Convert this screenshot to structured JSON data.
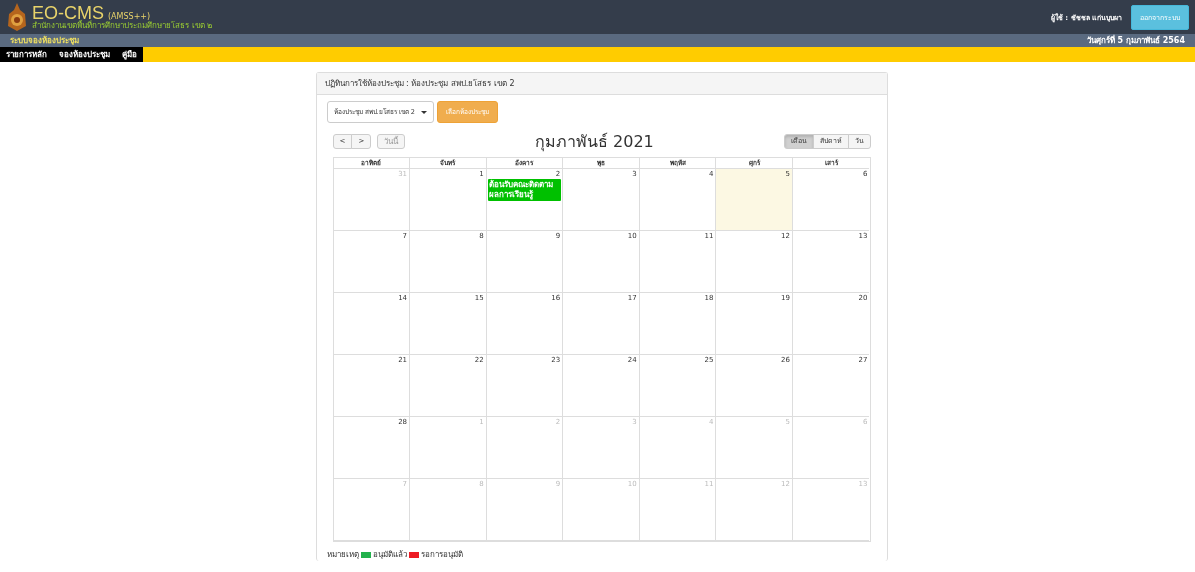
{
  "header": {
    "logo_title": "EO-CMS",
    "logo_suffix": "(AMSS++)",
    "subtitle": "สำนักงานเขตพื้นที่การศึกษาประถมศึกษายโสธร เขต ๒",
    "user": "ผู้ใช้ : ชัชชล แก่นบุบผา",
    "logout": "ออกจากระบบ"
  },
  "subbar": {
    "system": "ระบบจองห้องประชุม",
    "date": "วันศุกร์ที่ 5 กุมภาพันธ์ 2564"
  },
  "menu": [
    "รายการหลัก",
    "จองห้องประชุม",
    "คู่มือ"
  ],
  "panel": {
    "title": "ปฏิทินการใช้ห้องประชุม : ห้องประชุม สพป.ยโสธร เขต 2",
    "room_select": "ห้องประชุม สพป.ยโสธร เขต 2",
    "choose_button": "เลือกห้องประชุม"
  },
  "toolbar": {
    "prev": "<",
    "next": ">",
    "today": "วันนี้",
    "title": "กุมภาพันธ์ 2021",
    "views": [
      {
        "label": "เดือน",
        "selected": true
      },
      {
        "label": "สัปดาห์",
        "selected": false
      },
      {
        "label": "วัน",
        "selected": false
      }
    ]
  },
  "weekdays": [
    "อาทิตย์",
    "จันทร์",
    "อังคาร",
    "พุธ",
    "พฤหัส",
    "ศุกร์",
    "เสาร์"
  ],
  "weeks": [
    [
      {
        "day": "31",
        "other_month": true,
        "today": false
      },
      {
        "day": "1",
        "other_month": false,
        "today": false
      },
      {
        "day": "2",
        "other_month": false,
        "today": false,
        "events": [
          {
            "title": "ต้อนรับคณะติดตามผลการเรียนรู้",
            "color": "#00c000"
          }
        ]
      },
      {
        "day": "3",
        "other_month": false,
        "today": false
      },
      {
        "day": "4",
        "other_month": false,
        "today": false
      },
      {
        "day": "5",
        "other_month": false,
        "today": true
      },
      {
        "day": "6",
        "other_month": false,
        "today": false
      }
    ],
    [
      {
        "day": "7",
        "other_month": false,
        "today": false
      },
      {
        "day": "8",
        "other_month": false,
        "today": false
      },
      {
        "day": "9",
        "other_month": false,
        "today": false
      },
      {
        "day": "10",
        "other_month": false,
        "today": false
      },
      {
        "day": "11",
        "other_month": false,
        "today": false
      },
      {
        "day": "12",
        "other_month": false,
        "today": false
      },
      {
        "day": "13",
        "other_month": false,
        "today": false
      }
    ],
    [
      {
        "day": "14",
        "other_month": false,
        "today": false
      },
      {
        "day": "15",
        "other_month": false,
        "today": false
      },
      {
        "day": "16",
        "other_month": false,
        "today": false
      },
      {
        "day": "17",
        "other_month": false,
        "today": false
      },
      {
        "day": "18",
        "other_month": false,
        "today": false
      },
      {
        "day": "19",
        "other_month": false,
        "today": false
      },
      {
        "day": "20",
        "other_month": false,
        "today": false
      }
    ],
    [
      {
        "day": "21",
        "other_month": false,
        "today": false
      },
      {
        "day": "22",
        "other_month": false,
        "today": false
      },
      {
        "day": "23",
        "other_month": false,
        "today": false
      },
      {
        "day": "24",
        "other_month": false,
        "today": false
      },
      {
        "day": "25",
        "other_month": false,
        "today": false
      },
      {
        "day": "26",
        "other_month": false,
        "today": false
      },
      {
        "day": "27",
        "other_month": false,
        "today": false
      }
    ],
    [
      {
        "day": "28",
        "other_month": false,
        "today": false
      },
      {
        "day": "1",
        "other_month": true,
        "today": false
      },
      {
        "day": "2",
        "other_month": true,
        "today": false
      },
      {
        "day": "3",
        "other_month": true,
        "today": false
      },
      {
        "day": "4",
        "other_month": true,
        "today": false
      },
      {
        "day": "5",
        "other_month": true,
        "today": false
      },
      {
        "day": "6",
        "other_month": true,
        "today": false
      }
    ],
    [
      {
        "day": "7",
        "other_month": true,
        "today": false
      },
      {
        "day": "8",
        "other_month": true,
        "today": false
      },
      {
        "day": "9",
        "other_month": true,
        "today": false
      },
      {
        "day": "10",
        "other_month": true,
        "today": false
      },
      {
        "day": "11",
        "other_month": true,
        "today": false
      },
      {
        "day": "12",
        "other_month": true,
        "today": false
      },
      {
        "day": "13",
        "other_month": true,
        "today": false
      }
    ]
  ],
  "legend": {
    "label": "หมายเหตุ",
    "items": [
      {
        "label": "อนุมัติแล้ว",
        "color": "#22b14c"
      },
      {
        "label": "รอการอนุมัติ",
        "color": "#ed1c24"
      }
    ]
  }
}
